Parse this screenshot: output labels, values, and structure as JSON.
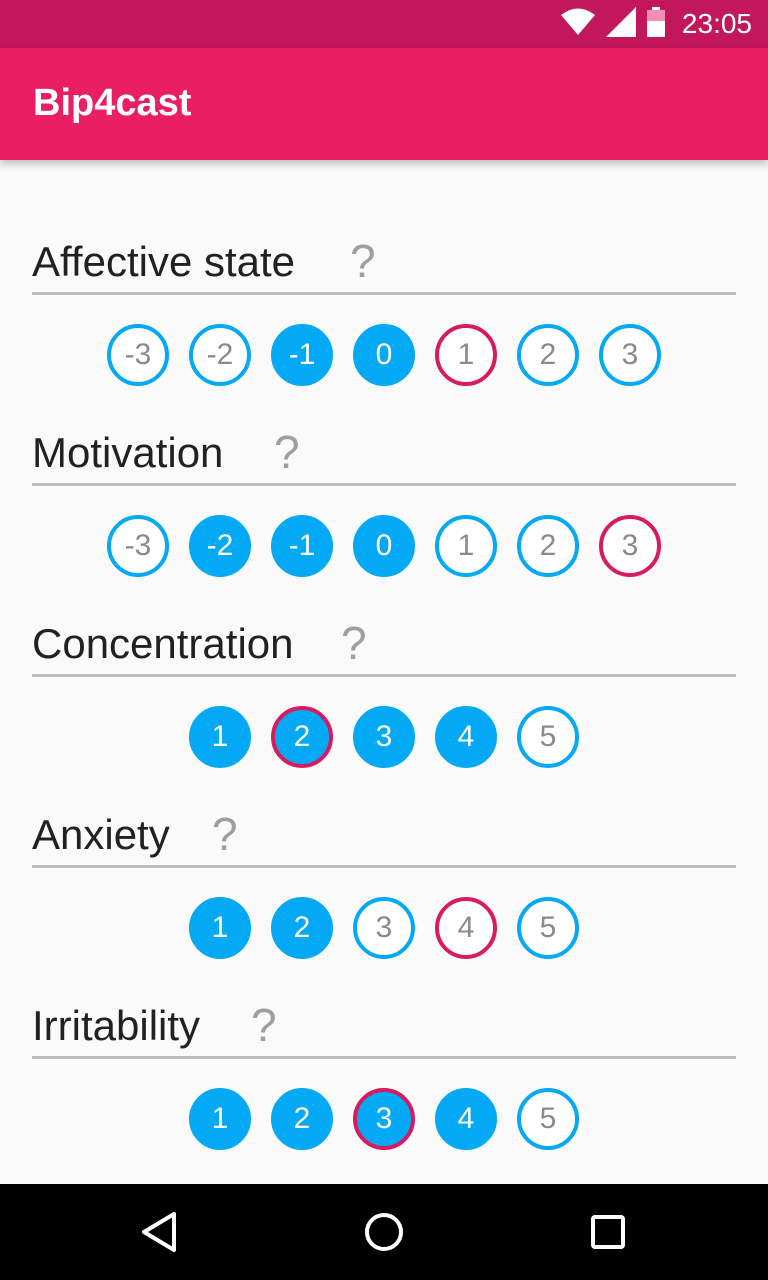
{
  "status_bar": {
    "time": "23:05",
    "icons": [
      "wifi-icon",
      "signal-icon",
      "battery-icon"
    ],
    "color": "#c2185b"
  },
  "app_bar": {
    "title": "Bip4cast",
    "color": "#e91e63"
  },
  "colors": {
    "selected_fill": "#03a9f4",
    "current_border": "#d81b60"
  },
  "questions": [
    {
      "label": "Affective state",
      "help_icon": "?",
      "options": [
        {
          "label": "-3",
          "filled": false,
          "current": false
        },
        {
          "label": "-2",
          "filled": false,
          "current": false
        },
        {
          "label": "-1",
          "filled": true,
          "current": false
        },
        {
          "label": "0",
          "filled": true,
          "current": false
        },
        {
          "label": "1",
          "filled": false,
          "current": true
        },
        {
          "label": "2",
          "filled": false,
          "current": false
        },
        {
          "label": "3",
          "filled": false,
          "current": false
        }
      ]
    },
    {
      "label": "Motivation",
      "help_icon": "?",
      "options": [
        {
          "label": "-3",
          "filled": false,
          "current": false
        },
        {
          "label": "-2",
          "filled": true,
          "current": false
        },
        {
          "label": "-1",
          "filled": true,
          "current": false
        },
        {
          "label": "0",
          "filled": true,
          "current": false
        },
        {
          "label": "1",
          "filled": false,
          "current": false
        },
        {
          "label": "2",
          "filled": false,
          "current": false
        },
        {
          "label": "3",
          "filled": false,
          "current": true
        }
      ]
    },
    {
      "label": "Concentration",
      "help_icon": "?",
      "options": [
        {
          "label": "1",
          "filled": true,
          "current": false
        },
        {
          "label": "2",
          "filled": true,
          "current": true
        },
        {
          "label": "3",
          "filled": true,
          "current": false
        },
        {
          "label": "4",
          "filled": true,
          "current": false
        },
        {
          "label": "5",
          "filled": false,
          "current": false
        }
      ]
    },
    {
      "label": "Anxiety",
      "help_icon": "?",
      "options": [
        {
          "label": "1",
          "filled": true,
          "current": false
        },
        {
          "label": "2",
          "filled": true,
          "current": false
        },
        {
          "label": "3",
          "filled": false,
          "current": false
        },
        {
          "label": "4",
          "filled": false,
          "current": true
        },
        {
          "label": "5",
          "filled": false,
          "current": false
        }
      ]
    },
    {
      "label": "Irritability",
      "help_icon": "?",
      "options": [
        {
          "label": "1",
          "filled": true,
          "current": false
        },
        {
          "label": "2",
          "filled": true,
          "current": false
        },
        {
          "label": "3",
          "filled": true,
          "current": true
        },
        {
          "label": "4",
          "filled": true,
          "current": false
        },
        {
          "label": "5",
          "filled": false,
          "current": false
        }
      ]
    }
  ],
  "nav_bar": {
    "buttons": [
      "back-icon",
      "home-icon",
      "recents-icon"
    ]
  }
}
